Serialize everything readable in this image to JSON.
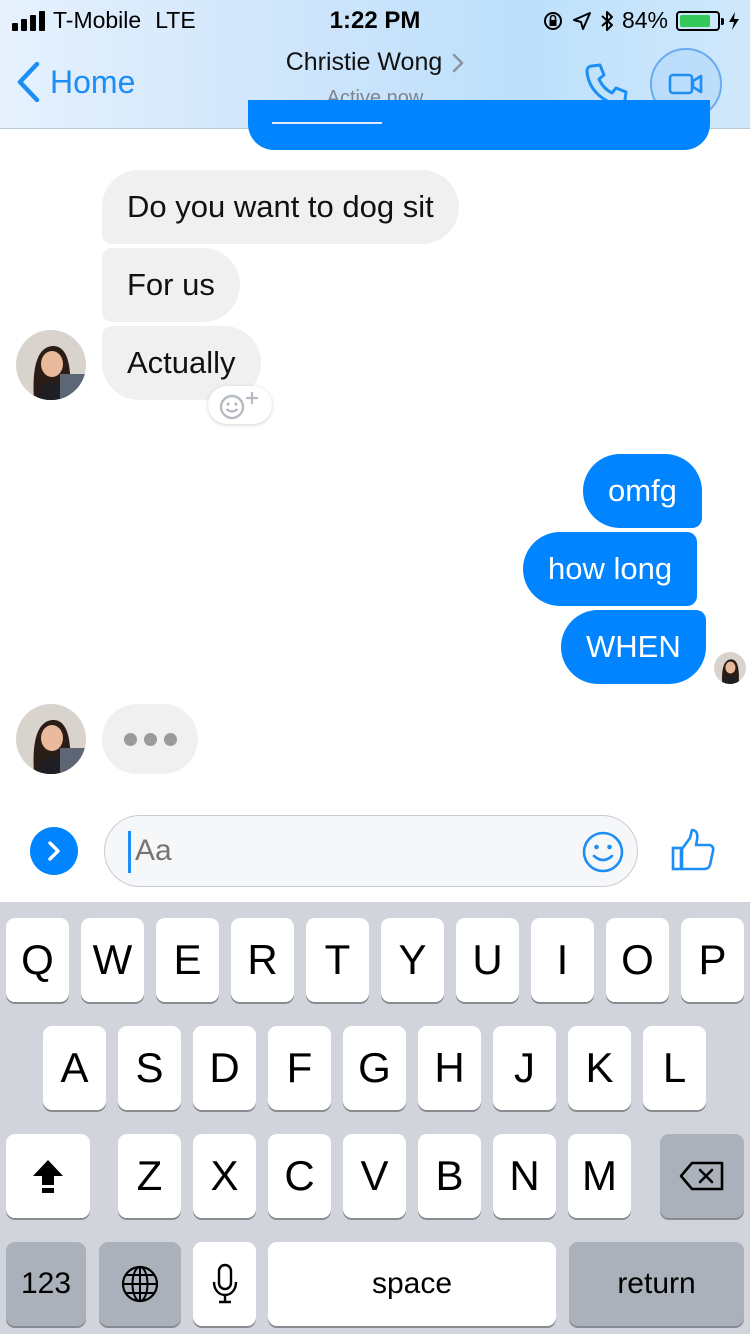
{
  "status_bar": {
    "carrier": "T-Mobile",
    "network": "LTE",
    "time": "1:22 PM",
    "battery_percent": "84%",
    "battery_level": 0.84,
    "icons": [
      "signal-icon",
      "rotation-lock-icon",
      "location-icon",
      "bluetooth-icon",
      "battery-icon",
      "charging-icon"
    ]
  },
  "header": {
    "back_label": "Home",
    "contact_name": "Christie Wong",
    "presence": "Active now",
    "icons": [
      "chevron-left-icon",
      "chevron-right-icon",
      "phone-icon",
      "video-camera-icon"
    ]
  },
  "messages": [
    {
      "from": "them",
      "text": "Do you want to dog sit"
    },
    {
      "from": "them",
      "text": "For us"
    },
    {
      "from": "them",
      "text": "Actually"
    },
    {
      "from": "me",
      "text": "omfg"
    },
    {
      "from": "me",
      "text": "how long"
    },
    {
      "from": "me",
      "text": "WHEN"
    }
  ],
  "composer": {
    "placeholder": "Aa",
    "icons": [
      "expand-chevron-icon",
      "emoji-icon",
      "thumbs-up-icon",
      "add-reaction-icon"
    ]
  },
  "keyboard": {
    "row1": [
      "Q",
      "W",
      "E",
      "R",
      "T",
      "Y",
      "U",
      "I",
      "O",
      "P"
    ],
    "row2": [
      "A",
      "S",
      "D",
      "F",
      "G",
      "H",
      "J",
      "K",
      "L"
    ],
    "row3": [
      "Z",
      "X",
      "C",
      "V",
      "B",
      "N",
      "M"
    ],
    "numbers_key": "123",
    "space_key": "space",
    "return_key": "return",
    "icons": [
      "shift-icon",
      "backspace-icon",
      "globe-icon",
      "microphone-icon"
    ]
  },
  "colors": {
    "accent": "#0084ff",
    "link_blue": "#1d8ef5",
    "incoming_bubble": "#f0f0f0",
    "battery_green": "#34c759",
    "keyboard_bg": "#d1d5db"
  }
}
